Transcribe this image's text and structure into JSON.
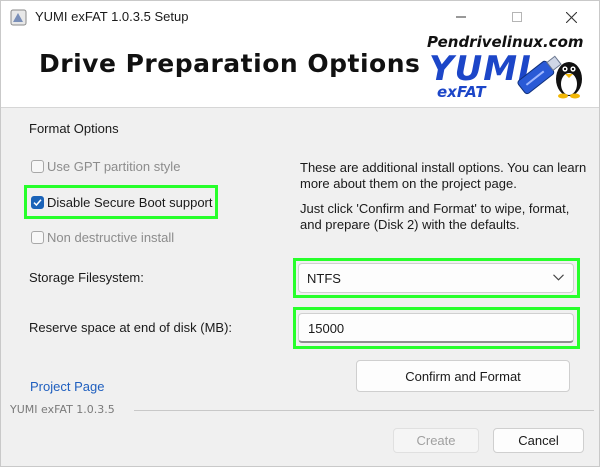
{
  "window": {
    "title": "YUMI exFAT 1.0.3.5 Setup",
    "controls": [
      "minimize",
      "maximize",
      "close"
    ]
  },
  "banner": {
    "heading": "Drive Preparation Options",
    "logo": {
      "site": "Pendrivelinux.com",
      "name": "YUMI",
      "variant": "exFAT"
    }
  },
  "format_options": {
    "group_label": "Format Options",
    "gpt": {
      "label": "Use GPT partition style",
      "checked": false,
      "enabled": false
    },
    "secure_boot": {
      "label": "Disable Secure Boot support",
      "checked": true,
      "enabled": true
    },
    "non_destructive": {
      "label": "Non destructive install",
      "checked": false,
      "enabled": false
    }
  },
  "info": {
    "line1": "These are additional install options. You can learn more about them on the project page.",
    "line2": "Just click 'Confirm and Format' to wipe, format, and prepare (Disk 2) with the defaults."
  },
  "storage": {
    "label": "Storage Filesystem:",
    "value": "NTFS"
  },
  "reserve": {
    "label": "Reserve space at end of disk (MB):",
    "value": "15000"
  },
  "buttons": {
    "confirm": "Confirm and Format",
    "create": "Create",
    "cancel": "Cancel"
  },
  "project_link": "Project Page",
  "version_text": "YUMI exFAT 1.0.3.5",
  "colors": {
    "highlight": "#27ff2b",
    "accent": "#1b63b8",
    "logo_blue": "#1c46c8"
  }
}
